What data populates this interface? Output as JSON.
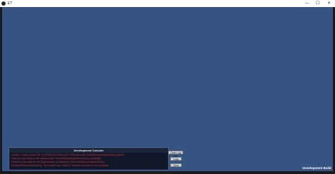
{
  "window": {
    "title": "ET",
    "minimize_glyph": "—",
    "maximize_glyph": "☐",
    "close_glyph": "✕"
  },
  "console": {
    "title": "Development Console",
    "lines": [
      "Unable to load texture file: D:/ET/BUILD-VN/LA-KTT-ENHanced/B_Data/StreamingAssets/a.png/test",
      "Failed to find data for the Addressable: Share/EtAddressable/UIDemo-untask86",
      "Failed to load data for the Addressable (LoadAsset): Share/EtAddressable/UIDemo",
      "ResApp/ResourcesMissing: The prefab was 'Main/UI' and the resource is not available."
    ],
    "buttons": {
      "open_log": "Open Log File",
      "copy": "Copy",
      "clear": "Clear"
    }
  },
  "footer": {
    "build_label": "Development Build"
  },
  "colors": {
    "viewport": "#355383",
    "error_text": "#d23030"
  }
}
